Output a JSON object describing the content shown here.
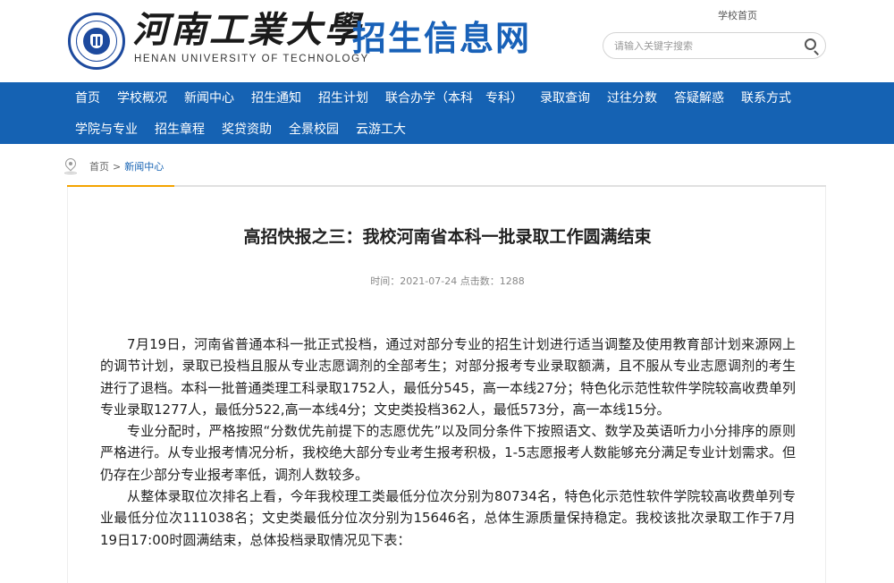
{
  "header": {
    "school_name_cn": "河南工業大學",
    "school_name_en": "HENAN UNIVERSITY OF TECHNOLOGY",
    "site_name": "招生信息网",
    "home_link": "学校首页",
    "search_placeholder": "请输入关键字搜索",
    "brand_color": "#1562b3"
  },
  "nav": {
    "row1": [
      "首页",
      "学校概况",
      "新闻中心",
      "招生通知",
      "招生计划",
      "联合办学（本科　专科）",
      "录取查询",
      "过往分数",
      "答疑解惑",
      "联系方式"
    ],
    "row2": [
      "学院与专业",
      "招生章程",
      "奖贷资助",
      "全景校园",
      "云游工大"
    ]
  },
  "breadcrumb": {
    "home": "首页",
    "separator": ">",
    "current": "新闻中心"
  },
  "article": {
    "title": "高招快报之三：我校河南省本科一批录取工作圆满结束",
    "meta": "时间：2021-07-24 点击数：1288",
    "paragraphs": [
      "7月19日，河南省普通本科一批正式投档，通过对部分专业的招生计划进行适当调整及使用教育部计划来源网上的调节计划，录取已投档且服从专业志愿调剂的全部考生；对部分报考专业录取额满，且不服从专业志愿调剂的考生进行了退档。本科一批普通类理工科录取1752人，最低分545，高一本线27分；特色化示范性软件学院较高收费单列专业录取1277人，最低分522,高一本线4分；文史类投档362人，最低573分，高一本线15分。",
      "专业分配时，严格按照“分数优先前提下的志愿优先”以及同分条件下按照语文、数学及英语听力小分排序的原则严格进行。从专业报考情况分析，我校绝大部分专业考生报考积极，1-5志愿报考人数能够充分满足专业计划需求。但仍存在少部分专业报考率低，调剂人数较多。",
      "从整体录取位次排名上看，今年我校理工类最低分位次分别为80734名，特色化示范性软件学院较高收费单列专业最低分位次111038名；文史类最低分位次分别为15646名，总体生源质量保持稳定。我校该批次录取工作于7月19日17:00时圆满结束，总体投档录取情况见下表："
    ]
  }
}
